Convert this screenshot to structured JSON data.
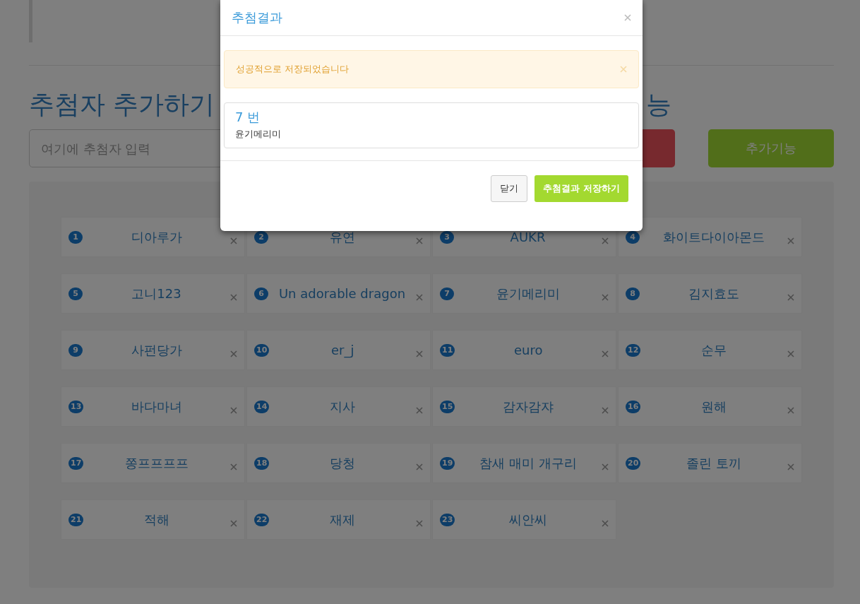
{
  "page": {
    "heading_left": "추첨자 추가하기",
    "heading_right": "능",
    "input_placeholder": "여기에 추첨자 입력",
    "extra_button": "추가기능"
  },
  "entries": [
    {
      "number": "1",
      "name": "디아루가"
    },
    {
      "number": "2",
      "name": "유연"
    },
    {
      "number": "3",
      "name": "AUKR"
    },
    {
      "number": "4",
      "name": "화이트다이아몬드"
    },
    {
      "number": "5",
      "name": "고니123"
    },
    {
      "number": "6",
      "name": "Un adorable dragon"
    },
    {
      "number": "7",
      "name": "윤기메리미"
    },
    {
      "number": "8",
      "name": "김지효도"
    },
    {
      "number": "9",
      "name": "사펀당가"
    },
    {
      "number": "10",
      "name": "er_j"
    },
    {
      "number": "11",
      "name": "euro"
    },
    {
      "number": "12",
      "name": "순무"
    },
    {
      "number": "13",
      "name": "바다마녀"
    },
    {
      "number": "14",
      "name": "지사"
    },
    {
      "number": "15",
      "name": "감자감쟈"
    },
    {
      "number": "16",
      "name": "원해"
    },
    {
      "number": "17",
      "name": "쫑프프프프"
    },
    {
      "number": "18",
      "name": "당청"
    },
    {
      "number": "19",
      "name": "참새 매미 개구리"
    },
    {
      "number": "20",
      "name": "졸린 토끼"
    },
    {
      "number": "21",
      "name": "적해"
    },
    {
      "number": "22",
      "name": "재제"
    },
    {
      "number": "23",
      "name": "씨안씨"
    }
  ],
  "modal": {
    "title": "추첨결과",
    "alert": "성공적으로 저장되었습니다",
    "result": {
      "number": "7 번",
      "name": "윤기메리미"
    },
    "buttons": [
      {
        "label": "닫기",
        "kind": "default"
      },
      {
        "label": "추첨결과 저장하기",
        "kind": "primary"
      }
    ]
  }
}
